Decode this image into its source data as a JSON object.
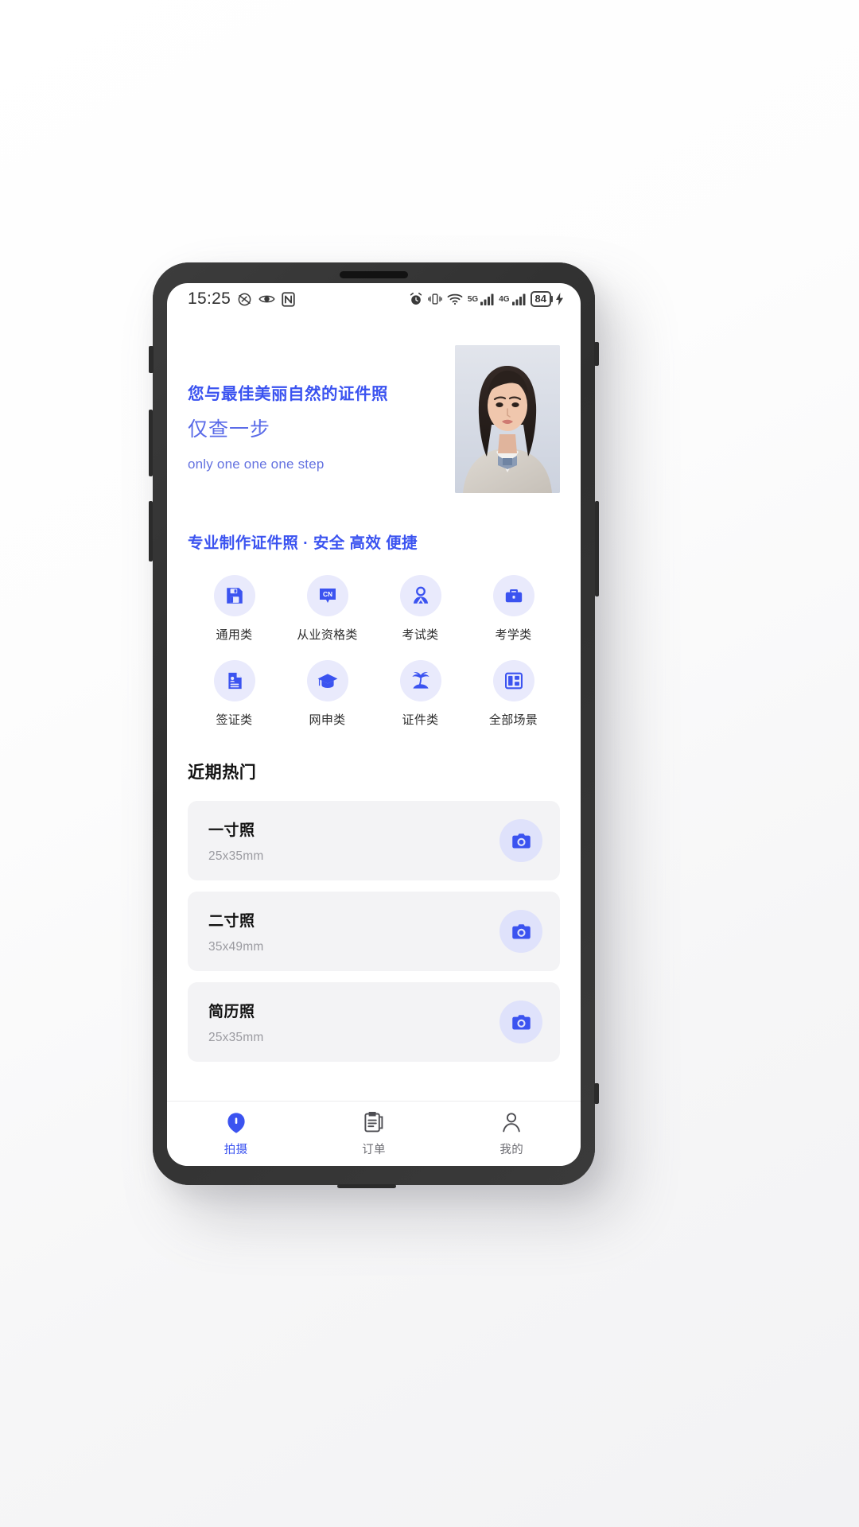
{
  "status_bar": {
    "time": "15:25",
    "left_icons": [
      "speed-limit-icon",
      "eye-care-icon",
      "nfc-icon"
    ],
    "right_icons": [
      "alarm-icon",
      "vibrate-icon",
      "wifi-icon"
    ],
    "network_5g_label": "5G",
    "network_4g_label": "4G",
    "battery_percent": "84",
    "charging": true
  },
  "hero": {
    "headline_cn": "您与最佳美丽自然的证件照",
    "subline_cn": "仅查一步",
    "subline_en": "only one one one step",
    "photo_alt": "portrait-sample"
  },
  "promo": {
    "heading": "专业制作证件照 · 安全 高效 便捷"
  },
  "categories": [
    {
      "label": "通用类",
      "icon": "floppy-disk-icon"
    },
    {
      "label": "从业资格类",
      "icon": "cn-badge-icon"
    },
    {
      "label": "考试类",
      "icon": "person-icon"
    },
    {
      "label": "考学类",
      "icon": "briefcase-icon"
    },
    {
      "label": "签证类",
      "icon": "id-document-icon"
    },
    {
      "label": "网申类",
      "icon": "graduation-cap-icon"
    },
    {
      "label": "证件类",
      "icon": "palm-tree-icon"
    },
    {
      "label": "全部场景",
      "icon": "grid-layout-icon"
    }
  ],
  "hot": {
    "heading": "近期热门",
    "items": [
      {
        "title": "一寸照",
        "size": "25x35mm",
        "action_icon": "camera-icon"
      },
      {
        "title": "二寸照",
        "size": "35x49mm",
        "action_icon": "camera-icon"
      },
      {
        "title": "简历照",
        "size": "25x35mm",
        "action_icon": "camera-icon"
      }
    ]
  },
  "bottom_nav": {
    "items": [
      {
        "label": "拍摄",
        "icon": "camera-shoot-icon",
        "active": true
      },
      {
        "label": "订单",
        "icon": "order-list-icon",
        "active": false
      },
      {
        "label": "我的",
        "icon": "user-profile-icon",
        "active": false
      }
    ]
  },
  "colors": {
    "brand_blue": "#3b53f0",
    "icon_tint_bg": "#e9eafc",
    "card_bg": "#f3f3f5",
    "muted_text": "#9a9aa0"
  }
}
